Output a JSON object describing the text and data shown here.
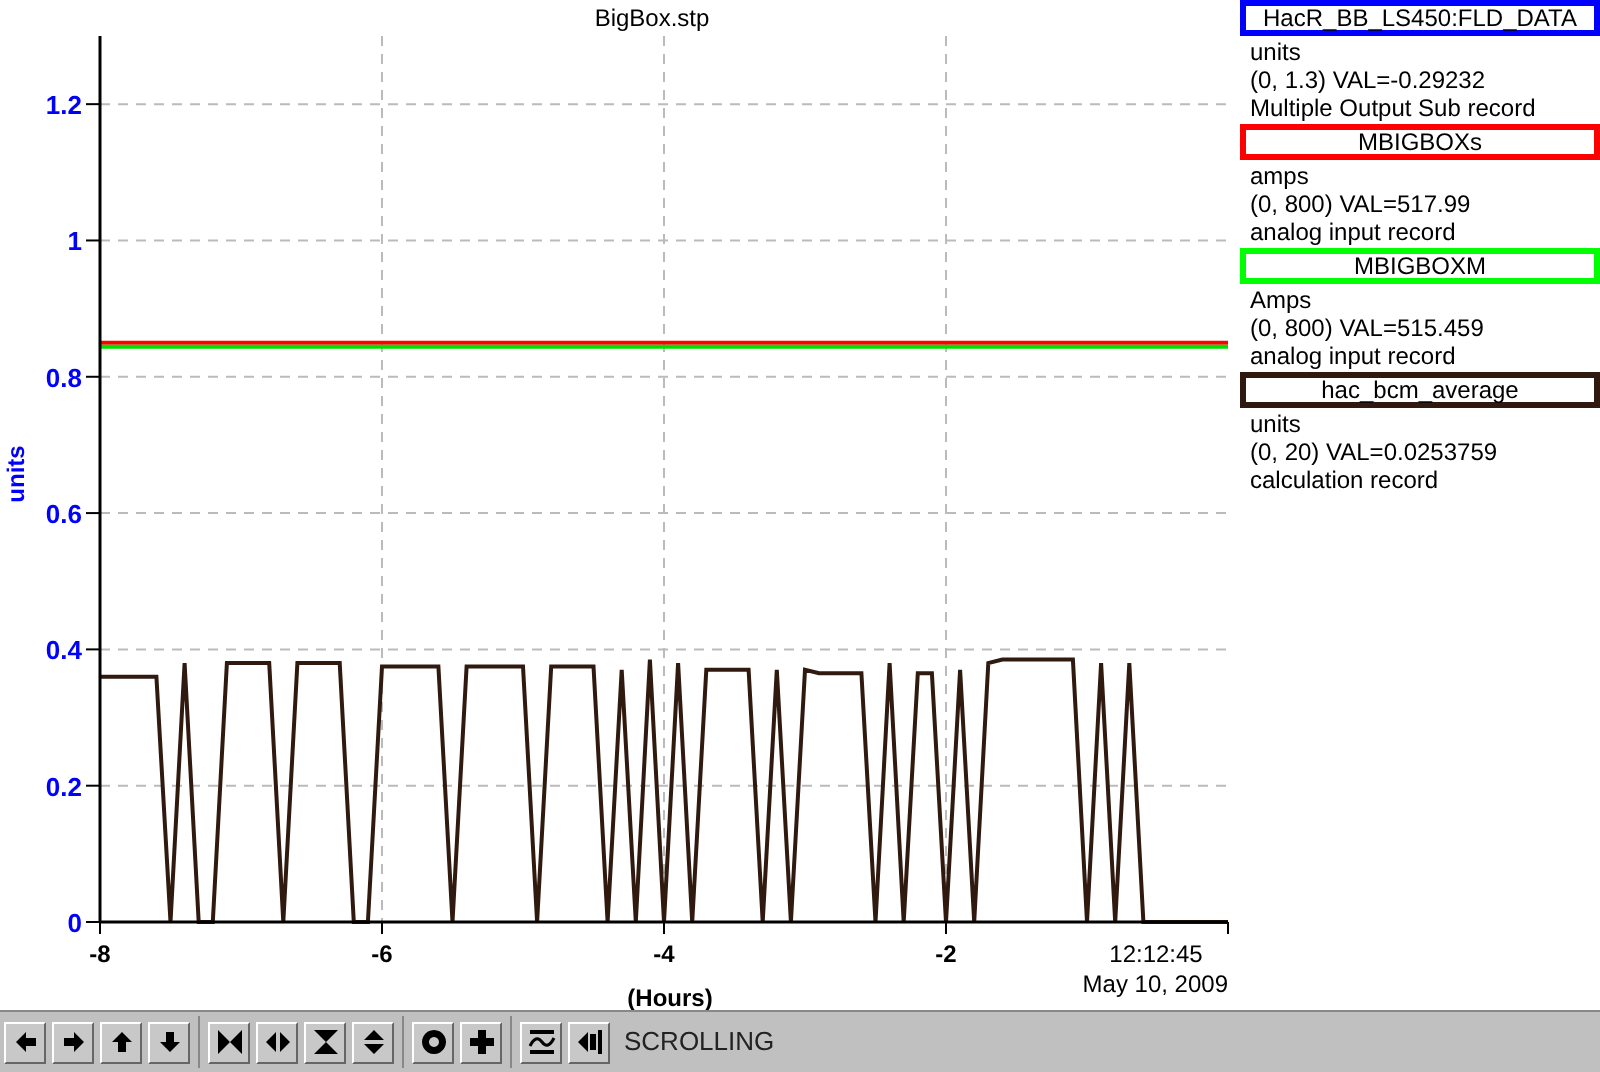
{
  "chart": {
    "title": "BigBox.stp",
    "time": "12:12:45",
    "date": "May 10, 2009",
    "chart_data": {
      "type": "line",
      "grid": true,
      "xlabel": "(Hours)",
      "ylabel": "units",
      "xlim": [
        -8,
        0
      ],
      "ylim": [
        0,
        1.3
      ],
      "xticks": [
        -8,
        -6,
        -4,
        -2
      ],
      "yticks": [
        0,
        0.2,
        0.4,
        0.6,
        0.8,
        1,
        1.2
      ],
      "x": [
        -8,
        -7.9,
        -7.8,
        -7.7,
        -7.6,
        -7.5,
        -7.4,
        -7.3,
        -7.2,
        -7.1,
        -7,
        -6.9,
        -6.8,
        -6.7,
        -6.6,
        -6.5,
        -6.4,
        -6.3,
        -6.2,
        -6.1,
        -6,
        -5.9,
        -5.8,
        -5.7,
        -5.6,
        -5.5,
        -5.4,
        -5.3,
        -5.2,
        -5.1,
        -5,
        -4.9,
        -4.8,
        -4.7,
        -4.6,
        -4.5,
        -4.4,
        -4.3,
        -4.2,
        -4.1,
        -4,
        -3.9,
        -3.8,
        -3.7,
        -3.6,
        -3.5,
        -3.4,
        -3.3,
        -3.2,
        -3.1,
        -3,
        -2.9,
        -2.8,
        -2.7,
        -2.6,
        -2.5,
        -2.4,
        -2.3,
        -2.2,
        -2.1,
        -2,
        -1.9,
        -1.8,
        -1.7,
        -1.6,
        -1.5,
        -1.4,
        -1.3,
        -1.2,
        -1.1,
        -1,
        -0.9,
        -0.8,
        -0.7,
        -0.6,
        -0.5,
        -0.4,
        -0.3,
        -0.2,
        -0.1,
        0
      ],
      "series": [
        {
          "color": "#ff0000",
          "values": [
            0.85,
            0.85,
            0.85,
            0.85,
            0.85,
            0.85,
            0.85,
            0.85,
            0.85,
            0.85,
            0.85,
            0.85,
            0.85,
            0.85,
            0.85,
            0.85,
            0.85,
            0.85,
            0.85,
            0.85,
            0.85,
            0.85,
            0.85,
            0.85,
            0.85,
            0.85,
            0.85,
            0.85,
            0.85,
            0.85,
            0.85,
            0.85,
            0.85,
            0.85,
            0.85,
            0.85,
            0.85,
            0.85,
            0.85,
            0.85,
            0.85,
            0.85,
            0.85,
            0.85,
            0.85,
            0.85,
            0.85,
            0.85,
            0.85,
            0.85,
            0.85,
            0.85,
            0.85,
            0.85,
            0.85,
            0.85,
            0.85,
            0.85,
            0.85,
            0.85,
            0.85,
            0.85,
            0.85,
            0.85,
            0.85,
            0.85,
            0.85,
            0.85,
            0.85,
            0.85,
            0.85,
            0.85,
            0.85,
            0.85,
            0.85,
            0.85,
            0.85,
            0.85,
            0.85,
            0.85,
            0.85
          ]
        },
        {
          "color": "#00e000",
          "values": [
            0.844,
            0.844,
            0.844,
            0.844,
            0.844,
            0.844,
            0.844,
            0.844,
            0.844,
            0.844,
            0.844,
            0.844,
            0.844,
            0.844,
            0.844,
            0.844,
            0.844,
            0.844,
            0.844,
            0.844,
            0.844,
            0.844,
            0.844,
            0.844,
            0.844,
            0.844,
            0.844,
            0.844,
            0.844,
            0.844,
            0.844,
            0.844,
            0.844,
            0.844,
            0.844,
            0.844,
            0.844,
            0.844,
            0.844,
            0.844,
            0.844,
            0.844,
            0.844,
            0.844,
            0.844,
            0.844,
            0.844,
            0.844,
            0.844,
            0.844,
            0.844,
            0.844,
            0.844,
            0.844,
            0.844,
            0.844,
            0.844,
            0.844,
            0.844,
            0.844,
            0.844,
            0.844,
            0.844,
            0.844,
            0.844,
            0.844,
            0.844,
            0.844,
            0.844,
            0.844,
            0.844,
            0.844,
            0.844,
            0.844,
            0.844,
            0.844,
            0.844,
            0.844,
            0.844,
            0.844,
            0.844
          ]
        },
        {
          "color": "#301a10",
          "values": [
            0.36,
            0.36,
            0.36,
            0.36,
            0.36,
            0,
            0.38,
            0,
            0,
            0.38,
            0.38,
            0.38,
            0.38,
            0,
            0.38,
            0.38,
            0.38,
            0.38,
            0,
            0,
            0.375,
            0.375,
            0.375,
            0.375,
            0.375,
            0,
            0.375,
            0.375,
            0.375,
            0.375,
            0.375,
            0,
            0.375,
            0.375,
            0.375,
            0.375,
            0,
            0.37,
            0,
            0.385,
            0,
            0.38,
            0,
            0.37,
            0.37,
            0.37,
            0.37,
            0,
            0.37,
            0,
            0.37,
            0.365,
            0.365,
            0.365,
            0.365,
            0,
            0.38,
            0,
            0.365,
            0.365,
            0,
            0.37,
            0,
            0.38,
            0.385,
            0.385,
            0.385,
            0.385,
            0.385,
            0.385,
            0,
            0.38,
            0,
            0.38,
            0,
            0,
            0,
            0,
            0,
            0,
            0
          ]
        }
      ]
    }
  },
  "legend": [
    {
      "name": "HacR_BB_LS450:FLD_DATA",
      "color": "#0000ff",
      "units": "units",
      "range_value": "(0, 1.3) VAL=-0.29232",
      "record_type": "Multiple Output Sub record"
    },
    {
      "name": "MBIGBOXs",
      "color": "#ff0000",
      "units": "amps",
      "range_value": "(0, 800) VAL=517.99",
      "record_type": "analog input record"
    },
    {
      "name": "MBIGBOXM",
      "color": "#00ff00",
      "units": "Amps",
      "range_value": "(0, 800) VAL=515.459",
      "record_type": "analog input record"
    },
    {
      "name": "hac_bcm_average",
      "color": "#301a10",
      "units": "units",
      "range_value": "(0, 20) VAL=0.0253759",
      "record_type": "calculation record"
    }
  ],
  "toolbar": {
    "buttons": [
      {
        "kind": "left"
      },
      {
        "kind": "right"
      },
      {
        "kind": "up"
      },
      {
        "kind": "down"
      },
      {
        "kind": "shrink-h"
      },
      {
        "kind": "expand-h"
      },
      {
        "kind": "shrink-v"
      },
      {
        "kind": "expand-v"
      },
      {
        "kind": "circle"
      },
      {
        "kind": "plus"
      },
      {
        "kind": "wave"
      },
      {
        "kind": "back"
      }
    ],
    "status": "SCROLLING"
  }
}
